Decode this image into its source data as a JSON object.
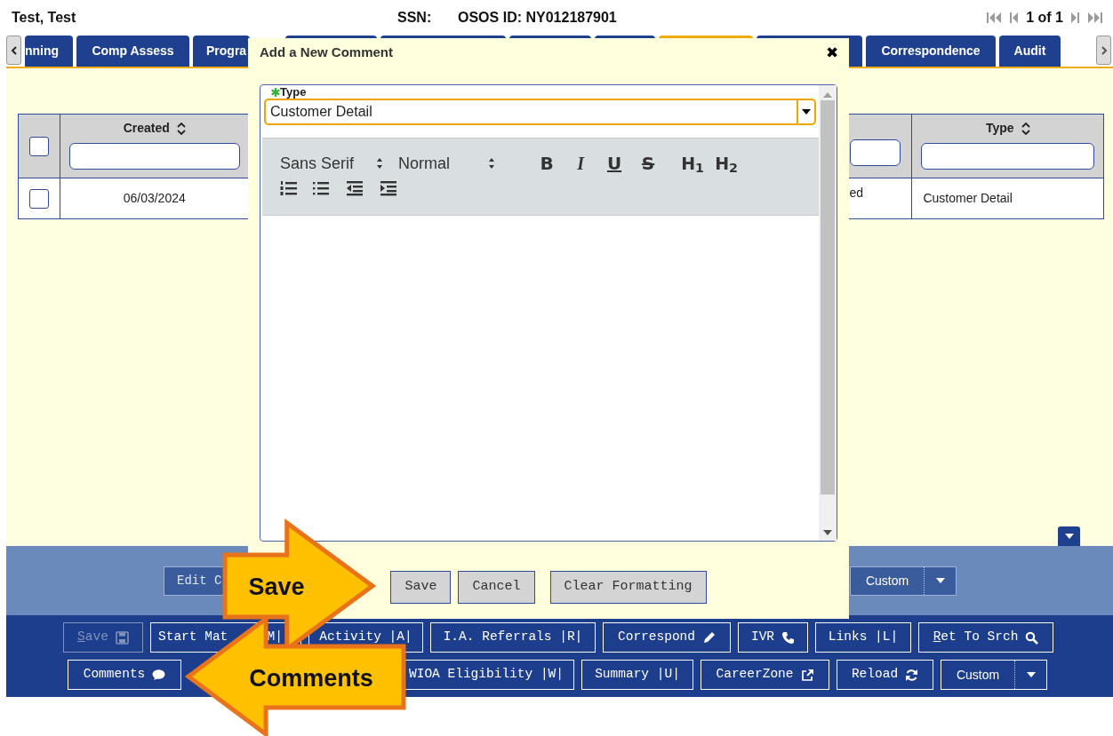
{
  "header": {
    "name": "Test, Test",
    "ssn_label": "SSN:",
    "osos_id": "OSOS ID: NY012187901",
    "pager_text": "1 of 1"
  },
  "tabs": [
    {
      "label": "nning",
      "selected": false
    },
    {
      "label": "Comp Assess",
      "selected": false
    },
    {
      "label": "Progra",
      "selected": false
    },
    {
      "selected": false
    },
    {
      "selected": false
    },
    {
      "selected": false
    },
    {
      "selected": false
    },
    {
      "selected": true
    },
    {
      "selected": false
    },
    {
      "label": "Correspondence",
      "selected": false
    },
    {
      "label": "Audit",
      "selected": false
    }
  ],
  "table": {
    "header_checked": false,
    "columns": [
      {
        "kind": "sortable",
        "label": "Created"
      },
      {
        "kind": "partial"
      },
      {
        "kind": "sortable",
        "label": "Type"
      }
    ],
    "rows": [
      {
        "checked": false,
        "cells": [
          "06/03/2024",
          "ed",
          "Customer Detail"
        ]
      }
    ]
  },
  "dialog": {
    "title": "Add a New Comment",
    "close": "✖",
    "type_field": {
      "label": "Type",
      "required": true,
      "value": "Customer Detail"
    },
    "editor": {
      "font": "Sans Serif",
      "size": "Normal",
      "format_buttons": [
        "B",
        "I",
        "U",
        "S",
        "H$_{1}$",
        "H$_{2}$"
      ]
    },
    "buttons": [
      "Save",
      "Cancel",
      "Clear Formatting"
    ]
  },
  "action_bar": {
    "buttons": [
      {
        "kind": "plain",
        "label": "Edit C"
      },
      {
        "kind": "split",
        "label": "Custom"
      }
    ]
  },
  "button_rows": [
    [
      {
        "kind": "text",
        "label": "Save",
        "disabled": true,
        "underline_first": true
      },
      {
        "kind": "text",
        "label": "Start Mat",
        "label_tail": "M|",
        "disabled": false,
        "underline_first": false
      },
      {
        "kind": "text",
        "label": "Activity |A|",
        "disabled": false,
        "underline_first": false
      },
      {
        "kind": "text",
        "label": "I.A. Referrals |R|",
        "disabled": false,
        "underline_first": false
      },
      {
        "kind": "text",
        "label": "Correspond",
        "disabled": false,
        "underline_first": false
      },
      {
        "kind": "text",
        "label": "IVR",
        "disabled": false,
        "underline_first": false
      },
      {
        "kind": "text",
        "label": "Links |L|",
        "disabled": false,
        "underline_first": false
      },
      {
        "kind": "text",
        "label": "Ret To Srch",
        "disabled": false,
        "underline_first": true
      }
    ],
    [
      {
        "kind": "text",
        "label": "Comments",
        "disabled": false,
        "underline_first": false
      },
      {
        "kind": "text",
        "label": "WIOA Eligibility |W|",
        "disabled": false,
        "underline_first": false
      },
      {
        "kind": "text",
        "label": "Summary |U|",
        "disabled": false,
        "underline_first": false
      },
      {
        "kind": "text",
        "label": "CareerZone",
        "disabled": false,
        "underline_first": false
      },
      {
        "kind": "text",
        "label": "Reload",
        "disabled": false,
        "underline_first": false
      },
      {
        "kind": "split",
        "label": "Custom",
        "disabled": false,
        "underline_first": false
      }
    ]
  ],
  "callouts": [
    {
      "kind": "right",
      "label": "Save"
    },
    {
      "kind": "left",
      "label": "Comments"
    }
  ]
}
